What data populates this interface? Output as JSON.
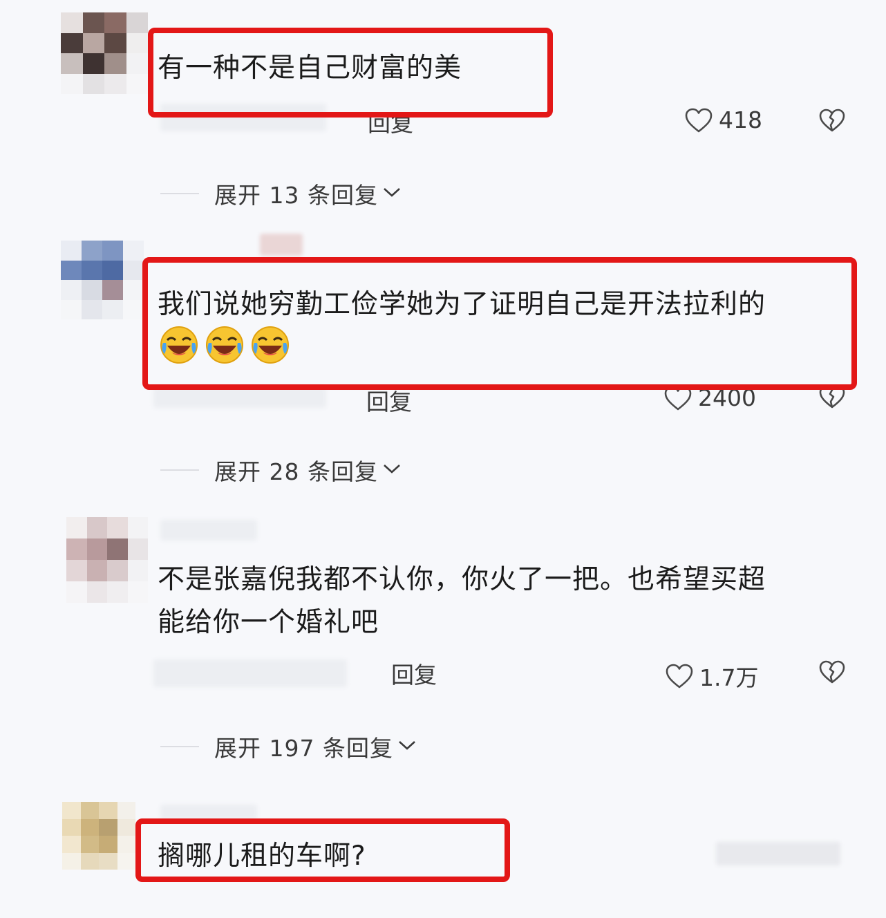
{
  "comments": [
    {
      "text": "有一种不是自己财富的美",
      "reply_label": "回复",
      "likes": "418",
      "expand_label": "展开 13 条回复"
    },
    {
      "text": "我们说她穷勤工俭学她为了证明自己是开法拉利的",
      "emojis": [
        "laughing-tears-emoji",
        "laughing-tears-emoji",
        "laughing-tears-emoji"
      ],
      "reply_label": "回复",
      "likes": "2400",
      "expand_label": "展开 28 条回复"
    },
    {
      "text": "不是张嘉倪我都不认你，你火了一把。也希望买超\n能给你一个婚礼吧",
      "reply_label": "回复",
      "likes": "1.7万",
      "expand_label": "展开 197 条回复"
    },
    {
      "text": "搁哪儿租的车啊?"
    }
  ],
  "icons": {
    "like": "heart-outline-icon",
    "dislike": "broken-heart-icon",
    "expand": "chevron-down-icon"
  },
  "colors": {
    "highlight": "#e31717",
    "background": "#f7f8fb"
  }
}
